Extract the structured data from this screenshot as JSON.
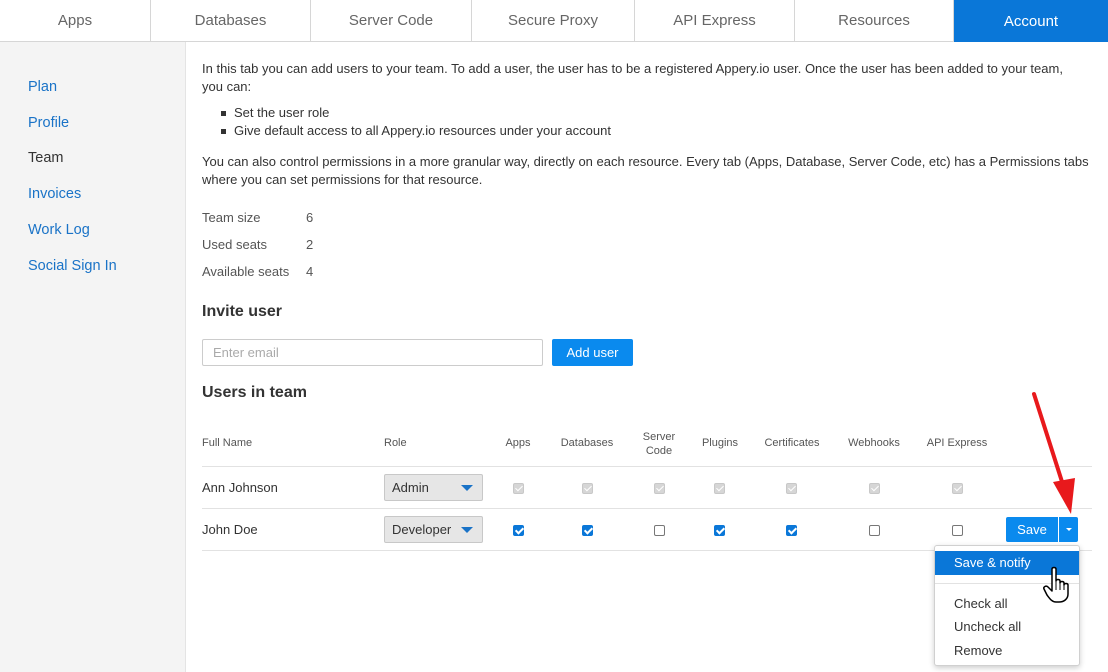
{
  "tabs": [
    {
      "label": "Apps"
    },
    {
      "label": "Databases"
    },
    {
      "label": "Server Code"
    },
    {
      "label": "Secure Proxy"
    },
    {
      "label": "API Express"
    },
    {
      "label": "Resources"
    },
    {
      "label": "Account",
      "active": true
    }
  ],
  "sidebar": {
    "items": [
      {
        "label": "Plan"
      },
      {
        "label": "Profile"
      },
      {
        "label": "Team",
        "active": true
      },
      {
        "label": "Invoices"
      },
      {
        "label": "Work Log"
      },
      {
        "label": "Social Sign In"
      }
    ]
  },
  "intro": {
    "line1": "In this tab you can add users to your team. To add a user, the user has to be a registered Appery.io user. Once the user has been added to your team,",
    "line2": "you can:",
    "bullets": [
      "Set the user role",
      "Give default access to all Appery.io resources under your account"
    ],
    "perm_line1": "You can also control permissions in a more granular way, directly on each resource. Every tab (Apps, Database, Server Code, etc) has a Permissions tabs",
    "perm_line2": "where you can set permissions for that resource."
  },
  "stats": [
    {
      "label": "Team size",
      "value": "6"
    },
    {
      "label": "Used seats",
      "value": "2"
    },
    {
      "label": "Available seats",
      "value": "4"
    }
  ],
  "invite": {
    "heading": "Invite user",
    "email_placeholder": "Enter email",
    "add_button": "Add user"
  },
  "team": {
    "heading": "Users in team",
    "columns": [
      "Full Name",
      "Role",
      "Apps",
      "Databases",
      "Server\nCode",
      "Plugins",
      "Certificates",
      "Webhooks",
      "API Express"
    ],
    "rows": [
      {
        "name": "Ann Johnson",
        "role": "Admin",
        "perms": [
          true,
          true,
          true,
          true,
          true,
          true,
          true
        ],
        "locked": true
      },
      {
        "name": "John Doe",
        "role": "Developer",
        "perms": [
          true,
          true,
          false,
          true,
          true,
          false,
          false
        ],
        "locked": false
      }
    ],
    "save_label": "Save"
  },
  "save_menu": {
    "items": [
      "Save & notify",
      "Check all",
      "Uncheck all",
      "Remove"
    ],
    "highlighted": "Save & notify"
  },
  "colors": {
    "accent": "#0a77d8",
    "button": "#0a8aee",
    "annotation_arrow": "#e8191c"
  }
}
